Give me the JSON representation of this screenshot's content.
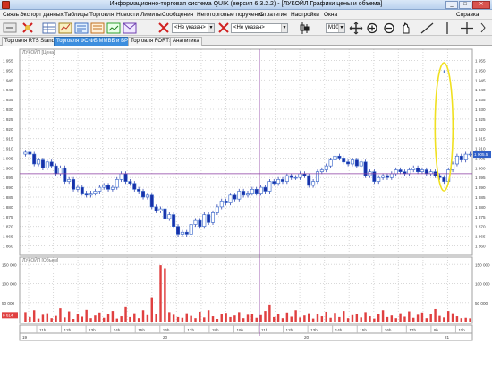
{
  "window": {
    "title": "Информационно-торговая система QUIK (версия 6.3.2.2) - [ЛУКОЙЛ Графики цены и объема]"
  },
  "menu": {
    "items": [
      "Связь",
      "Экспорт данных",
      "Таблицы",
      "Торговля",
      "Новости",
      "Лимиты",
      "Сообщения",
      "Неготорговые поручения",
      "Стратегия",
      "Настройки",
      "Окна"
    ],
    "help": "Справка"
  },
  "toolbar": {
    "combo1": "<Не указан>",
    "combo2": "<Не указан>",
    "interval": "M10"
  },
  "tabs": [
    "Торговля RTS Standard",
    "Торговля ФС ФБ ММВБ и БР РТС",
    "Торговля FORTS",
    "Аналитика"
  ],
  "price_panel": {
    "label": "ЛУКОЙЛ [Цена]",
    "current_price": "1 905.5",
    "y_ticks": [
      "1 955",
      "1 950",
      "1 945",
      "1 940",
      "1 935",
      "1 930",
      "1 925",
      "1 920",
      "1 915",
      "1 910",
      "1 905",
      "1 900",
      "1 895",
      "1 890",
      "1 885",
      "1 880",
      "1 875",
      "1 870",
      "1 865",
      "1 860"
    ]
  },
  "volume_panel": {
    "label": "ЛУКОЙЛ [Объем]",
    "current_volume": "8 614",
    "y_ticks": [
      "150 000",
      "100 000",
      "50 000"
    ]
  },
  "time_axis": {
    "hours": [
      "11h",
      "12h",
      "13h",
      "14h",
      "15h",
      "16h",
      "17h",
      "18h",
      "19h",
      "11h",
      "12h",
      "13h",
      "14h",
      "15h",
      "16h",
      "17h",
      "9h",
      "11h"
    ],
    "dates": [
      "19",
      "20",
      "20",
      "21"
    ]
  },
  "chart_data": [
    {
      "type": "candlestick",
      "title": "ЛУКОЙЛ [Цена]",
      "ylim": [
        1857,
        1958
      ],
      "y_ticks": [
        1955,
        1950,
        1945,
        1940,
        1935,
        1930,
        1925,
        1920,
        1915,
        1910,
        1905,
        1900,
        1895,
        1890,
        1885,
        1880,
        1875,
        1870,
        1865,
        1860
      ],
      "close": [
        1908,
        1907,
        1902,
        1904,
        1900,
        1903,
        1901,
        1897,
        1900,
        1893,
        1894,
        1889,
        1890,
        1887,
        1886,
        1887,
        1888,
        1890,
        1891,
        1889,
        1890,
        1894,
        1897,
        1893,
        1892,
        1889,
        1888,
        1885,
        1886,
        1880,
        1878,
        1879,
        1874,
        1876,
        1870,
        1866,
        1867,
        1866,
        1871,
        1873,
        1870,
        1876,
        1872,
        1877,
        1880,
        1883,
        1882,
        1886,
        1884,
        1888,
        1886,
        1887,
        1889,
        1887,
        1890,
        1888,
        1893,
        1892,
        1894,
        1893,
        1896,
        1895,
        1895,
        1897,
        1896,
        1891,
        1893,
        1898,
        1899,
        1901,
        1904,
        1906,
        1905,
        1903,
        1902,
        1904,
        1901,
        1903,
        1896,
        1898,
        1893,
        1895,
        1896,
        1895,
        1897,
        1899,
        1898,
        1897,
        1899,
        1900,
        1898,
        1899,
        1897,
        1898,
        1896,
        1895,
        1893,
        1899,
        1902,
        1906,
        1904,
        1907,
        1907
      ]
    },
    {
      "type": "bar",
      "title": "ЛУКОЙЛ [Объем]",
      "ylim": [
        0,
        160000
      ],
      "y_ticks": [
        150000,
        100000,
        50000
      ],
      "values": [
        25000,
        12000,
        30000,
        8000,
        18000,
        22000,
        9000,
        15000,
        35000,
        11000,
        27000,
        7000,
        20000,
        13000,
        31000,
        9000,
        16000,
        24000,
        10000,
        19000,
        28000,
        8000,
        14000,
        38000,
        12000,
        22000,
        9000,
        30000,
        17000,
        62000,
        20000,
        148000,
        140000,
        25000,
        18000,
        12000,
        10000,
        22000,
        15000,
        9000,
        26000,
        11000,
        30000,
        14000,
        7000,
        19000,
        23000,
        12000,
        16000,
        25000,
        9000,
        18000,
        21000,
        10000,
        17000,
        28000,
        45000,
        12000,
        20000,
        9000,
        24000,
        13000,
        30000,
        11000,
        16000,
        22000,
        8000,
        19000,
        14000,
        26000,
        10000,
        23000,
        12000,
        28000,
        9000,
        17000,
        21000,
        11000,
        25000,
        14000,
        8000,
        19000,
        30000,
        12000,
        16000,
        9000,
        22000,
        13000,
        27000,
        10000,
        18000,
        24000,
        9000,
        20000,
        33000,
        15000,
        11000,
        28000,
        22000,
        14000,
        9000,
        10000,
        8614
      ]
    }
  ],
  "colors": {
    "candle_up": "#3060c8",
    "candle_down": "#1830a8",
    "volume_bar": "#e04040",
    "current_price_tag": "#3060c8",
    "current_volume_tag": "#e04040",
    "annotation": "#f0e020",
    "crosshair": "#8a3aa0"
  }
}
